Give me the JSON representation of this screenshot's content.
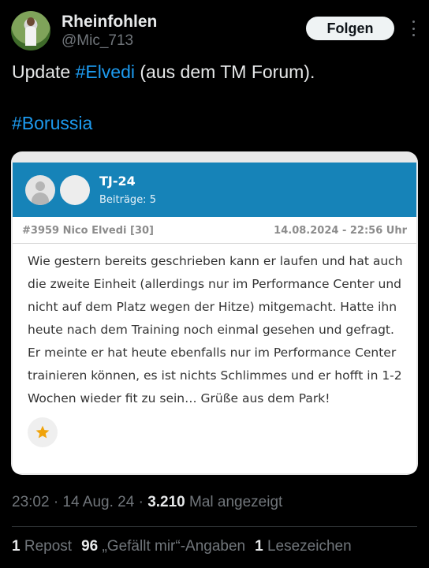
{
  "user": {
    "name": "Rheinfohlen",
    "handle": "@Mic_713",
    "follow_label": "Folgen"
  },
  "tweet": {
    "text_prefix": "Update ",
    "hashtag1": "#Elvedi",
    "text_suffix": " (aus dem TM Forum).",
    "hashtag2": "#Borussia"
  },
  "card": {
    "forum_user": "TJ-24",
    "forum_posts": "Beiträge: 5",
    "post_id": "#3959 Nico Elvedi [30]",
    "post_date": "14.08.2024 - 22:56 Uhr",
    "post_text": "Wie gestern bereits geschrieben kann er laufen und hat auch die zweite Einheit (allerdings nur im Performance Center und nicht auf dem Platz wegen der Hitze) mitgemacht. Hatte ihn heute nach dem Training noch einmal gesehen und gefragt. Er meinte er hat heute ebenfalls nur im Performance Center trainieren können, es ist nichts Schlimmes und er hofft in 1-2 Wochen wieder fit zu sein… Grüße aus dem Park!",
    "header_color": "#1683b8",
    "star_color": "#f0a30a"
  },
  "footer": {
    "time": "23:02 · 14 Aug. 24 · ",
    "views_count": "3.210",
    "views_label": " Mal angezeigt",
    "reposts_count": "1",
    "reposts_label": " Repost",
    "likes_count": "96",
    "likes_label": " „Gefällt mir“-Angaben",
    "bookmarks_count": "1",
    "bookmarks_label": " Lesezeichen"
  },
  "colors": {
    "background": "#000000",
    "link": "#1d9bf0",
    "muted": "#71767b"
  }
}
